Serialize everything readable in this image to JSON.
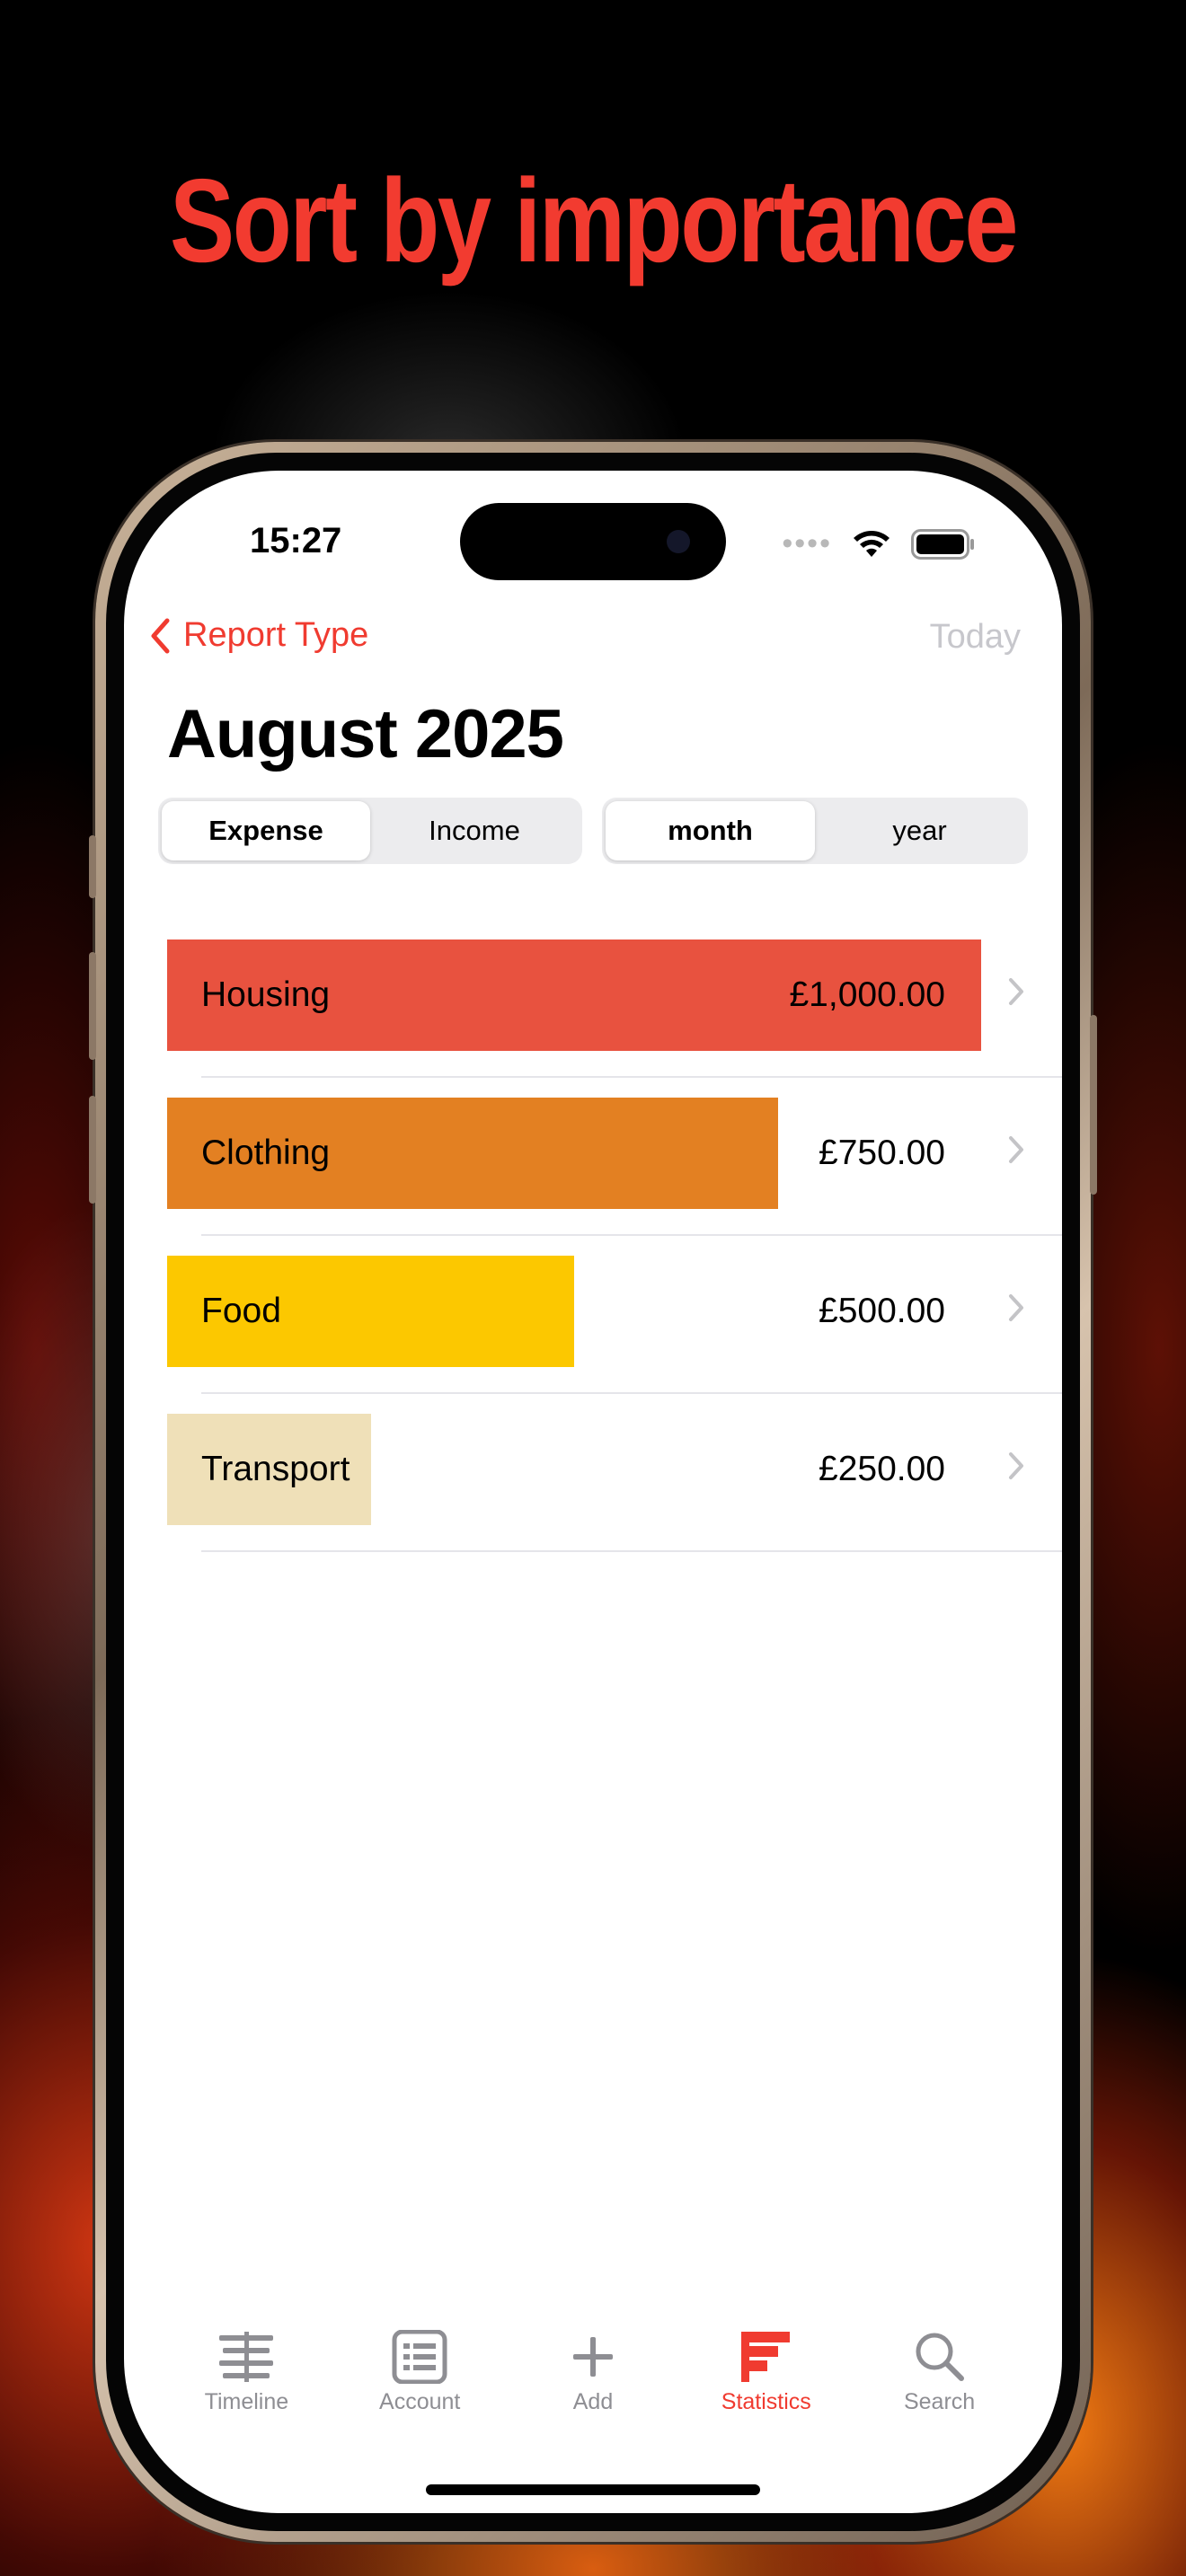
{
  "headline": "Sort by importance",
  "status_bar": {
    "time": "15:27"
  },
  "nav": {
    "back_label": "Report Type",
    "right_label": "Today"
  },
  "title": "August 2025",
  "type_segment": {
    "options": [
      "Expense",
      "Income"
    ],
    "selected": "Expense"
  },
  "period_segment": {
    "options": [
      "month",
      "year"
    ],
    "selected": "month"
  },
  "categories": [
    {
      "label": "Housing",
      "amount": "£1,000.00",
      "share": 1.0,
      "color": "#e8523f"
    },
    {
      "label": "Clothing",
      "amount": "£750.00",
      "share": 0.75,
      "color": "#e38022"
    },
    {
      "label": "Food",
      "amount": "£500.00",
      "share": 0.5,
      "color": "#fcc800"
    },
    {
      "label": "Transport",
      "amount": "£250.00",
      "share": 0.25,
      "color": "#efe0b8"
    }
  ],
  "tabs": [
    {
      "label": "Timeline",
      "icon": "timeline-icon"
    },
    {
      "label": "Account",
      "icon": "account-icon"
    },
    {
      "label": "Add",
      "icon": "plus-icon"
    },
    {
      "label": "Statistics",
      "icon": "statistics-icon",
      "active": true
    },
    {
      "label": "Search",
      "icon": "search-icon"
    }
  ],
  "colors": {
    "accent": "#f03b30",
    "inactive": "#8e8e93",
    "headline": "#f23b30"
  }
}
